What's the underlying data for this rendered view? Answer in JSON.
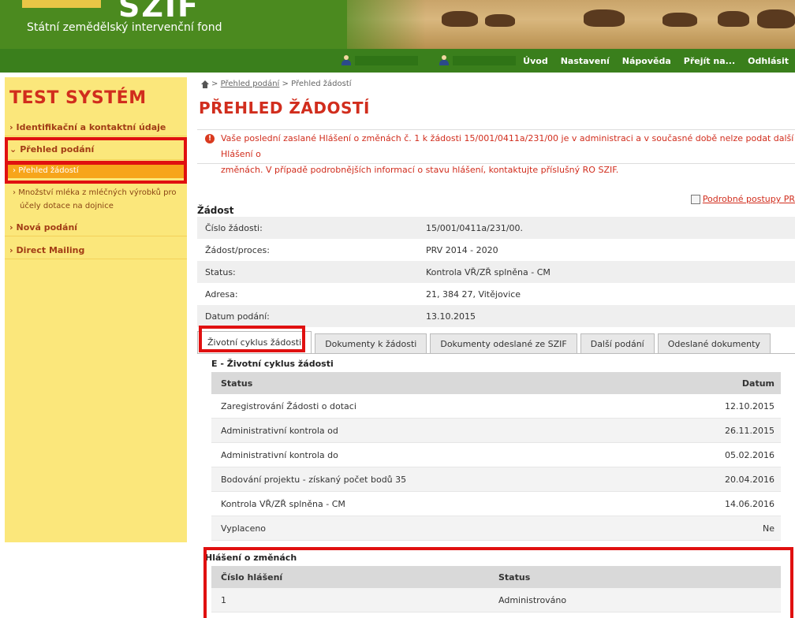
{
  "header": {
    "logo_text": "SZIF",
    "org_name": "Státní zemědělský intervenční fond"
  },
  "navbar": {
    "menu": [
      "Úvod",
      "Nastavení",
      "Nápověda",
      "Přejít na...",
      "Odhlásit"
    ]
  },
  "sidebar": {
    "title": "TEST SYSTÉM",
    "items": [
      {
        "label": "Identifikační a kontaktní údaje",
        "chevron": "›"
      },
      {
        "label": "Přehled podání",
        "chevron": "⌄"
      },
      {
        "label": "Nová podání",
        "chevron": "›"
      },
      {
        "label": "Direct Mailing",
        "chevron": "›"
      }
    ],
    "sub_active": "Přehled žádostí",
    "sub_other_line1": "Množství mléka z mléčných výrobků pro",
    "sub_other_line2": "účely dotace na dojnice"
  },
  "breadcrumb": {
    "link": "Přehled podání",
    "current": "Přehled žádostí",
    "separator": ">"
  },
  "page_title": "PŘEHLED ŽÁDOSTÍ",
  "alert": {
    "line1": "Vaše poslední zaslané Hlášení o změnách č. 1 k žádosti 15/001/0411a/231/00        je v administraci a v současné době nelze podat další Hlášení o",
    "line2": "změnách. V případě podrobnějších informací o stavu hlášení, kontaktujte příslušný RO SZIF."
  },
  "procedures_link": "Podrobné postupy PR",
  "zadost": {
    "heading": "Žádost",
    "rows": [
      {
        "key": "Číslo žádosti:",
        "value": "15/001/0411a/231/00."
      },
      {
        "key": "Žádost/proces:",
        "value": "PRV 2014 - 2020"
      },
      {
        "key": "Status:",
        "value": "Kontrola VŘ/ZŘ splněna - CM"
      },
      {
        "key": "Adresa:",
        "value": "21, 384 27, Vitějovice"
      },
      {
        "key": "Datum podání:",
        "value": "13.10.2015"
      }
    ]
  },
  "tabs": [
    "Životní cyklus žádosti",
    "Dokumenty k žádosti",
    "Dokumenty odeslané ze SZIF",
    "Další podání",
    "Odeslané dokumenty"
  ],
  "lifecycle": {
    "heading": "E - Životní cyklus žádosti",
    "col_status": "Status",
    "col_date": "Datum",
    "rows": [
      {
        "status": "Zaregistrování Žádosti o dotaci",
        "date": "12.10.2015"
      },
      {
        "status": "Administrativní kontrola od",
        "date": "26.11.2015"
      },
      {
        "status": "Administrativní kontrola do",
        "date": "05.02.2016"
      },
      {
        "status": "Bodování projektu - získaný počet bodů 35",
        "date": "20.04.2016"
      },
      {
        "status": "Kontrola VŘ/ZŘ splněna - CM",
        "date": "14.06.2016"
      },
      {
        "status": "Vyplaceno",
        "date": "Ne"
      }
    ]
  },
  "changes": {
    "heading": "Hlášení o změnách",
    "col_number": "Číslo hlášení",
    "col_status": "Status",
    "rows": [
      {
        "number": "1",
        "status": "Administrováno"
      }
    ]
  },
  "colors": {
    "header_green": "#3a7f1c",
    "sidebar_yellow": "#fbe77b",
    "title_red": "#d12d1d",
    "highlight_red": "#e01010",
    "active_orange": "#f7a51b"
  }
}
